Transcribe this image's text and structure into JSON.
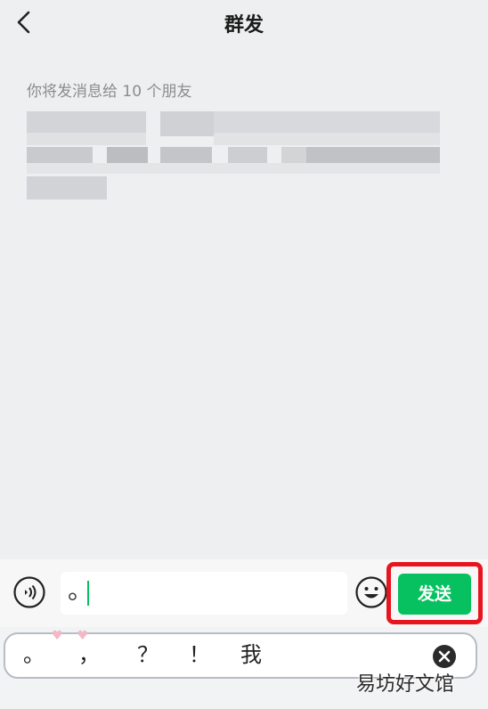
{
  "header": {
    "title": "群发",
    "back_icon": "chevron-left-icon"
  },
  "content": {
    "recipient_hint": "你将发消息给 10 个朋友"
  },
  "input_bar": {
    "voice_icon": "voice-icon",
    "input_value": "。",
    "emoji_icon": "emoji-icon",
    "send_label": "发送",
    "send_color": "#07c160",
    "highlight_color": "#e8151f"
  },
  "keyboard": {
    "suggestions": [
      "。",
      "，",
      "？",
      "！",
      "我"
    ],
    "clear_icon": "clear-icon"
  },
  "watermark": "易坊好文馆"
}
